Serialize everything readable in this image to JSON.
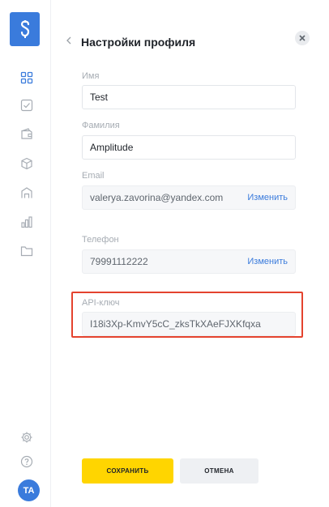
{
  "sidebar": {
    "logo_icon": "logo-dollar-icon",
    "items": [
      {
        "icon": "dashboard-grid-icon"
      },
      {
        "icon": "checkbox-icon"
      },
      {
        "icon": "wallet-icon"
      },
      {
        "icon": "box-icon"
      },
      {
        "icon": "building-icon"
      },
      {
        "icon": "bar-chart-icon"
      },
      {
        "icon": "folder-icon"
      }
    ],
    "bottom": [
      {
        "icon": "settings-gear-icon"
      },
      {
        "icon": "help-icon"
      }
    ],
    "avatar_initials": "TA"
  },
  "profile": {
    "title": "Настройки профиля",
    "first_name": {
      "label": "Имя",
      "value": "Test"
    },
    "last_name": {
      "label": "Фамилия",
      "value": "Amplitude"
    },
    "email": {
      "label": "Email",
      "value": "valerya.zavorina@yandex.com",
      "action": "Изменить"
    },
    "phone": {
      "label": "Телефон",
      "value": "79991112222",
      "action": "Изменить"
    },
    "api_key": {
      "label": "API-ключ",
      "value": "I18i3Xp-KmvY5cC_zksTkXAeFJXKfqxa"
    }
  },
  "actions": {
    "save_label": "СОХРАНИТЬ",
    "cancel_label": "ОТМЕНА"
  },
  "colors": {
    "accent": "#3a7bdc",
    "save": "#ffd500",
    "highlight": "#e4432e"
  }
}
